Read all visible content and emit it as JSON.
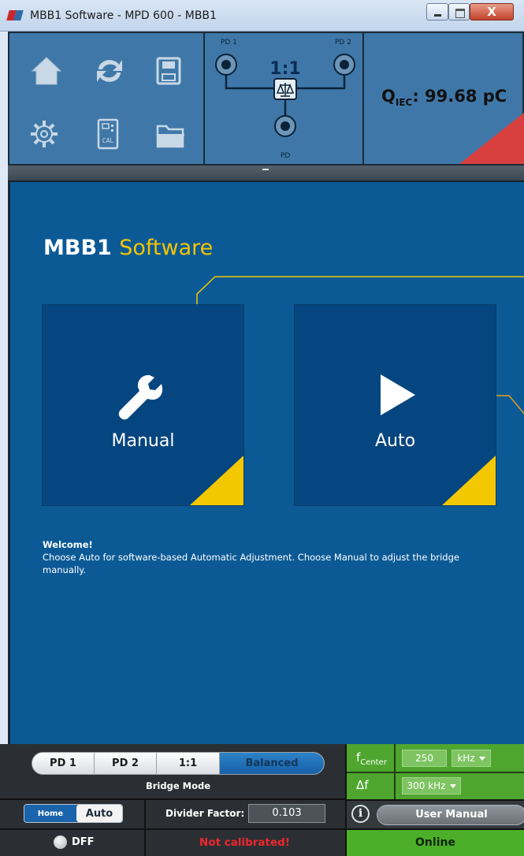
{
  "window": {
    "title": "MBB1 Software - MPD 600 - MBB1",
    "close_glyph": "X"
  },
  "toolbar": {
    "icons": [
      "home-icon",
      "refresh-icon",
      "save-icon",
      "settings-gear-icon",
      "calibration-icon",
      "open-folder-icon"
    ],
    "calibration_icon_text": "CAL"
  },
  "bridge_diagram": {
    "pd1_label": "PD 1",
    "pd2_label": "PD 2",
    "pd_label": "PD",
    "ratio": "1:1"
  },
  "charge": {
    "label_q": "Q",
    "label_sub": "IEC",
    "value": ": 99.68 pC"
  },
  "main": {
    "brand_bold": "MBB1",
    "brand_light": "Software",
    "tiles": {
      "manual": "Manual",
      "auto": "Auto"
    },
    "welcome_title": "Welcome!",
    "welcome_text": "Choose Auto for software-based Automatic Adjustment. Choose Manual to adjust the bridge manually."
  },
  "bottom": {
    "bridge_modes": [
      "PD 1",
      "PD 2",
      "1:1",
      "Balanced"
    ],
    "bridge_mode_selected": "Balanced",
    "bridge_mode_caption": "Bridge Mode",
    "home_label": "Home",
    "auto_label": "Auto",
    "divider_label": "Divider Factor:",
    "divider_value": "0.103",
    "dff_label": "DFF",
    "status_text": "Not calibrated!",
    "fcenter_label": "f",
    "fcenter_sub": "Center",
    "fcenter_value": "250",
    "fcenter_unit": "kHz",
    "df_label": "Δf",
    "df_value": "300 kHz",
    "info_glyph": "i",
    "user_manual": "User Manual",
    "connection": "Online"
  },
  "colors": {
    "main_bg": "#0b5a96",
    "tile_bg": "#064680",
    "accent_yellow": "#f3c800",
    "toolbar_bg": "#3f78a8",
    "filter_green": "#4ea62e",
    "alert_red": "#f0262d"
  }
}
